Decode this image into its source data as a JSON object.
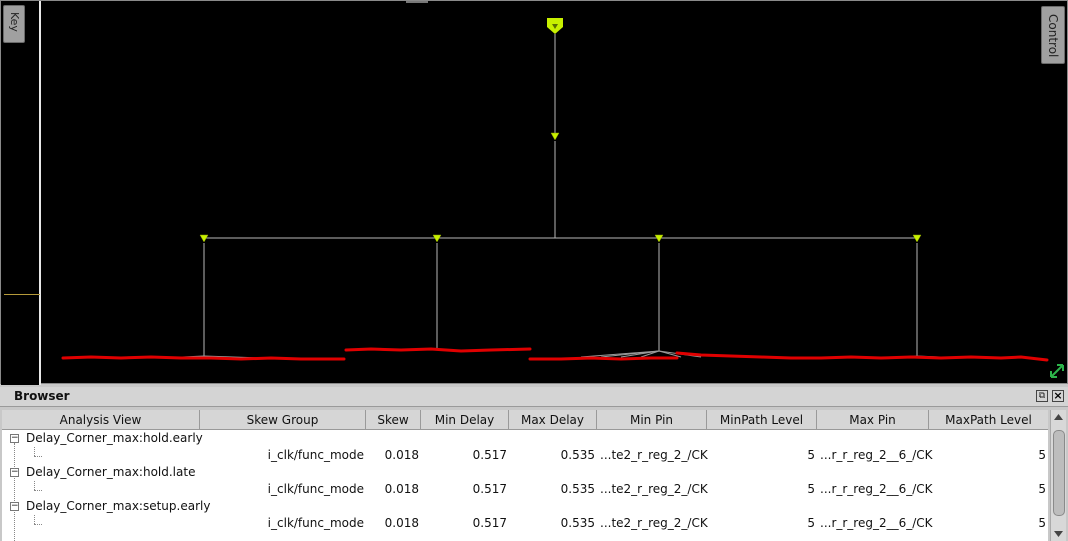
{
  "canvas": {
    "key_tab_label": "Key",
    "control_tab_label": "Control",
    "colors": {
      "background": "#000000",
      "wire": "#b8b8b8",
      "buffer": "#c8f000",
      "sink_bar": "#e00000"
    },
    "icons": {
      "root": "clock-root-icon",
      "buffer": "buffer-triangle-icon",
      "zoom": "zoom-fit-icon"
    }
  },
  "browser": {
    "title": "Browser",
    "restore_icon": "restore-icon",
    "close_icon": "close-icon",
    "columns": {
      "analysis_view": "Analysis View",
      "skew_group": "Skew Group",
      "skew": "Skew",
      "min_delay": "Min Delay",
      "max_delay": "Max Delay",
      "min_pin": "Min Pin",
      "min_path_level": "MinPath Level",
      "max_pin": "Max Pin",
      "max_path_level": "MaxPath Level"
    },
    "rows": [
      {
        "view": "Delay_Corner_max:hold.early",
        "skew_group": "i_clk/func_mode",
        "skew": "0.018",
        "min_delay": "0.517",
        "max_delay": "0.535",
        "min_pin": "...te2_r_reg_2_/CK",
        "min_path_level": "5",
        "max_pin": "...r_r_reg_2__6_/CK",
        "max_path_level": "5"
      },
      {
        "view": "Delay_Corner_max:hold.late",
        "skew_group": "i_clk/func_mode",
        "skew": "0.018",
        "min_delay": "0.517",
        "max_delay": "0.535",
        "min_pin": "...te2_r_reg_2_/CK",
        "min_path_level": "5",
        "max_pin": "...r_r_reg_2__6_/CK",
        "max_path_level": "5"
      },
      {
        "view": "Delay_Corner_max:setup.early",
        "skew_group": "i_clk/func_mode",
        "skew": "0.018",
        "min_delay": "0.517",
        "max_delay": "0.535",
        "min_pin": "...te2_r_reg_2_/CK",
        "min_path_level": "5",
        "max_pin": "...r_r_reg_2__6_/CK",
        "max_path_level": "5"
      }
    ]
  }
}
